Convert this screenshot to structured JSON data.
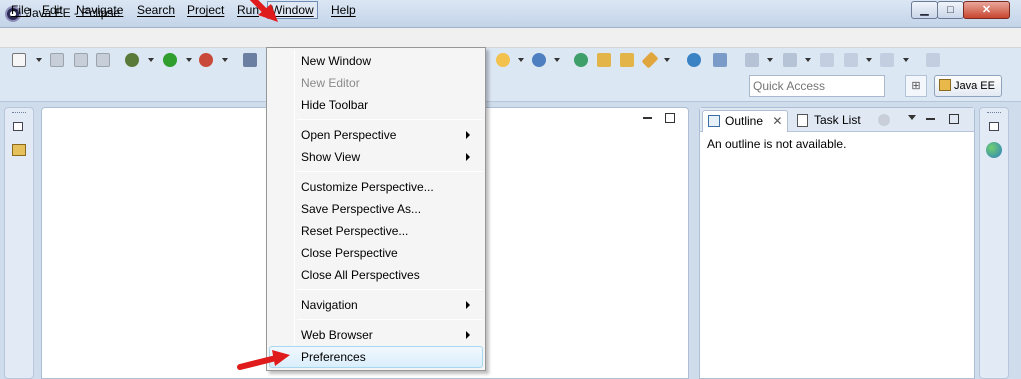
{
  "window": {
    "title": "Java EE - Eclipse"
  },
  "controls": {
    "minimize": "▁",
    "maximize": "□",
    "close": "✕"
  },
  "menubar": {
    "items": [
      "File",
      "Edit",
      "Navigate",
      "Search",
      "Project",
      "Run",
      "Window",
      "Help"
    ]
  },
  "toolbar": {
    "quick_access_placeholder": "Quick Access",
    "perspective_label": "Java EE"
  },
  "window_menu": {
    "items": [
      {
        "label": "New Window",
        "enabled": true,
        "submenu": false
      },
      {
        "label": "New Editor",
        "enabled": false,
        "submenu": false
      },
      {
        "label": "Hide Toolbar",
        "enabled": true,
        "submenu": false
      },
      {
        "label": "Open Perspective",
        "enabled": true,
        "submenu": true
      },
      {
        "label": "Show View",
        "enabled": true,
        "submenu": true
      },
      {
        "label": "Customize Perspective...",
        "enabled": true,
        "submenu": false
      },
      {
        "label": "Save Perspective As...",
        "enabled": true,
        "submenu": false
      },
      {
        "label": "Reset Perspective...",
        "enabled": true,
        "submenu": false
      },
      {
        "label": "Close Perspective",
        "enabled": true,
        "submenu": false
      },
      {
        "label": "Close All Perspectives",
        "enabled": true,
        "submenu": false
      },
      {
        "label": "Navigation",
        "enabled": true,
        "submenu": true
      },
      {
        "label": "Web Browser",
        "enabled": true,
        "submenu": true
      },
      {
        "label": "Preferences",
        "enabled": true,
        "submenu": false,
        "highlighted": true
      }
    ]
  },
  "outline": {
    "tabs": [
      "Outline",
      "Task List"
    ],
    "message": "An outline is not available."
  },
  "colors": {
    "annotation_arrow": "#e01b1b",
    "selection": "#d9eefb",
    "chrome": "#dce7f4"
  }
}
